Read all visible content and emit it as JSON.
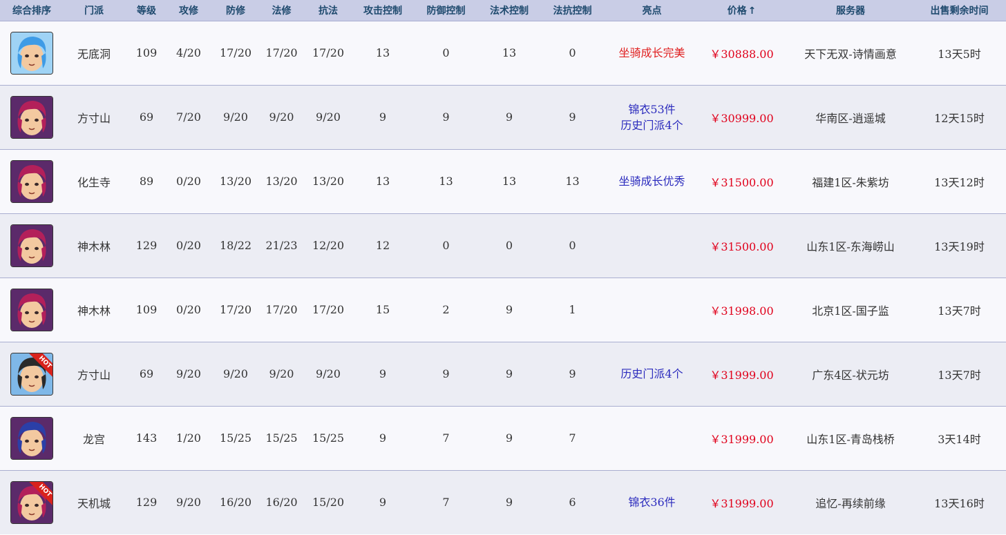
{
  "headers": {
    "rank": "综合排序",
    "school": "门派",
    "level": "等级",
    "atk_cult": "攻修",
    "def_cult": "防修",
    "mag_cult": "法修",
    "res_cult": "抗法",
    "atk_ctrl": "攻击控制",
    "def_ctrl": "防御控制",
    "mag_ctrl": "法术控制",
    "res_ctrl": "法抗控制",
    "highlights": "亮点",
    "price": "价格",
    "price_sort_arrow": "↑",
    "server": "服务器",
    "time_left": "出售剩余时间"
  },
  "colors": {
    "header_bg": "#c9cde6",
    "header_text": "#1f4a6e",
    "price_red": "#e0001b",
    "highlight_blue": "#2b2bbd",
    "highlight_red": "#e02020"
  },
  "rows": [
    {
      "avatar": "blue-hair-female-avatar-icon",
      "hot": "",
      "school": "无底洞",
      "level": "109",
      "atk_cult": "4/20",
      "def_cult": "17/20",
      "mag_cult": "17/20",
      "res_cult": "17/20",
      "atk_ctrl": "13",
      "def_ctrl": "0",
      "mag_ctrl": "13",
      "res_ctrl": "0",
      "highlights": [
        "坐骑成长完美"
      ],
      "highlight_color": "red",
      "price": "￥30888.00",
      "server": "天下无双-诗情画意",
      "time_left": "13天5时"
    },
    {
      "avatar": "red-hair-male-avatar-icon",
      "hot": "",
      "school": "方寸山",
      "level": "69",
      "atk_cult": "7/20",
      "def_cult": "9/20",
      "mag_cult": "9/20",
      "res_cult": "9/20",
      "atk_ctrl": "9",
      "def_ctrl": "9",
      "mag_ctrl": "9",
      "res_ctrl": "9",
      "highlights": [
        "锦衣53件",
        "历史门派4个"
      ],
      "highlight_color": "blue",
      "price": "￥30999.00",
      "server": "华南区-逍遥城",
      "time_left": "12天15时"
    },
    {
      "avatar": "red-hair-male-avatar-icon",
      "hot": "",
      "school": "化生寺",
      "level": "89",
      "atk_cult": "0/20",
      "def_cult": "13/20",
      "mag_cult": "13/20",
      "res_cult": "13/20",
      "atk_ctrl": "13",
      "def_ctrl": "13",
      "mag_ctrl": "13",
      "res_ctrl": "13",
      "highlights": [
        "坐骑成长优秀"
      ],
      "highlight_color": "blue",
      "price": "￥31500.00",
      "server": "福建1区-朱紫坊",
      "time_left": "13天12时"
    },
    {
      "avatar": "red-hair-male-avatar-icon",
      "hot": "",
      "school": "神木林",
      "level": "129",
      "atk_cult": "0/20",
      "def_cult": "18/22",
      "mag_cult": "21/23",
      "res_cult": "12/20",
      "atk_ctrl": "12",
      "def_ctrl": "0",
      "mag_ctrl": "0",
      "res_ctrl": "0",
      "highlights": [],
      "highlight_color": "blue",
      "price": "￥31500.00",
      "server": "山东1区-东海崂山",
      "time_left": "13天19时"
    },
    {
      "avatar": "red-hair-male-avatar-icon",
      "hot": "",
      "school": "神木林",
      "level": "109",
      "atk_cult": "0/20",
      "def_cult": "17/20",
      "mag_cult": "17/20",
      "res_cult": "17/20",
      "atk_ctrl": "15",
      "def_ctrl": "2",
      "mag_ctrl": "9",
      "res_ctrl": "1",
      "highlights": [],
      "highlight_color": "blue",
      "price": "￥31998.00",
      "server": "北京1区-国子监",
      "time_left": "13天7时"
    },
    {
      "avatar": "black-hair-male-avatar-icon",
      "hot": "HOT",
      "school": "方寸山",
      "level": "69",
      "atk_cult": "9/20",
      "def_cult": "9/20",
      "mag_cult": "9/20",
      "res_cult": "9/20",
      "atk_ctrl": "9",
      "def_ctrl": "9",
      "mag_ctrl": "9",
      "res_ctrl": "9",
      "highlights": [
        "历史门派4个"
      ],
      "highlight_color": "blue",
      "price": "￥31999.00",
      "server": "广东4区-状元坊",
      "time_left": "13天7时"
    },
    {
      "avatar": "blue-hair-male-avatar-icon",
      "hot": "",
      "school": "龙宫",
      "level": "143",
      "atk_cult": "1/20",
      "def_cult": "15/25",
      "mag_cult": "15/25",
      "res_cult": "15/25",
      "atk_ctrl": "9",
      "def_ctrl": "7",
      "mag_ctrl": "9",
      "res_ctrl": "7",
      "highlights": [],
      "highlight_color": "blue",
      "price": "￥31999.00",
      "server": "山东1区-青岛栈桥",
      "time_left": "3天14时"
    },
    {
      "avatar": "red-hair-male-avatar-icon",
      "hot": "HOT",
      "school": "天机城",
      "level": "129",
      "atk_cult": "9/20",
      "def_cult": "16/20",
      "mag_cult": "16/20",
      "res_cult": "15/20",
      "atk_ctrl": "9",
      "def_ctrl": "7",
      "mag_ctrl": "9",
      "res_ctrl": "6",
      "highlights": [
        "锦衣36件"
      ],
      "highlight_color": "blue",
      "price": "￥31999.00",
      "server": "追忆-再续前缘",
      "time_left": "13天16时"
    }
  ]
}
